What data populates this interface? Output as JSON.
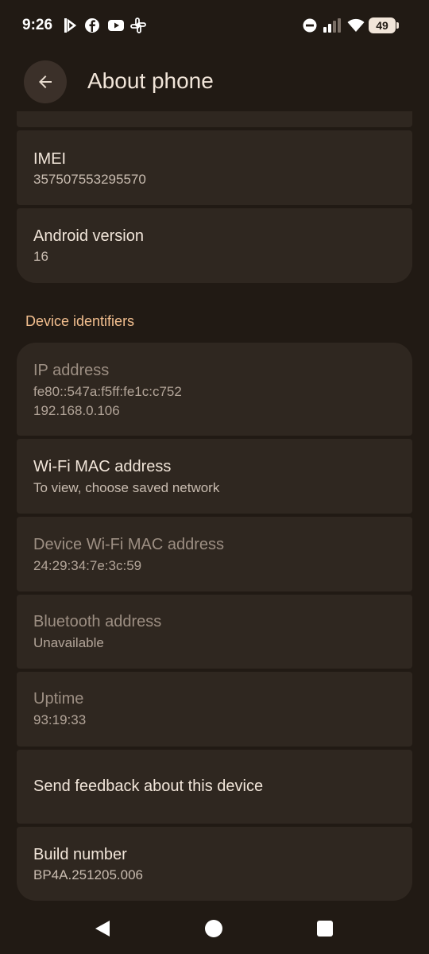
{
  "status_bar": {
    "time": "9:26",
    "battery_level": "49",
    "notification_icons": [
      "tiktok-icon",
      "facebook-icon",
      "youtube-icon",
      "slack-icon"
    ],
    "system_icons": [
      "do-not-disturb-icon",
      "signal-icon",
      "wifi-icon",
      "battery-icon"
    ]
  },
  "app_bar": {
    "title": "About phone",
    "back_icon": "arrow-back-icon"
  },
  "items_top": [
    {
      "title": "IMEI",
      "subtitle": "357507553295570",
      "enabled": true
    },
    {
      "title": "Android version",
      "subtitle": "16",
      "enabled": true
    }
  ],
  "section": {
    "header": "Device identifiers"
  },
  "ip_address": {
    "title": "IP address",
    "lines": [
      "fe80::547a:f5ff:fe1c:c752",
      "192.168.0.106"
    ],
    "enabled": false
  },
  "items_identifiers": [
    {
      "title": "Wi-Fi MAC address",
      "subtitle": "To view, choose saved network",
      "enabled": true
    },
    {
      "title": "Device Wi-Fi MAC address",
      "subtitle": "24:29:34:7e:3c:59",
      "enabled": false
    },
    {
      "title": "Bluetooth address",
      "subtitle": "Unavailable",
      "enabled": false
    },
    {
      "title": "Uptime",
      "subtitle": "93:19:33",
      "enabled": false
    }
  ],
  "feedback": {
    "title": "Send feedback about this device"
  },
  "build": {
    "title": "Build number",
    "subtitle": "BP4A.251205.006"
  },
  "colors": {
    "background": "#211a14",
    "card": "#2f2720",
    "accent": "#f3bf8f",
    "text_primary": "#f1e5d9",
    "text_disabled": "#9d8f83"
  }
}
